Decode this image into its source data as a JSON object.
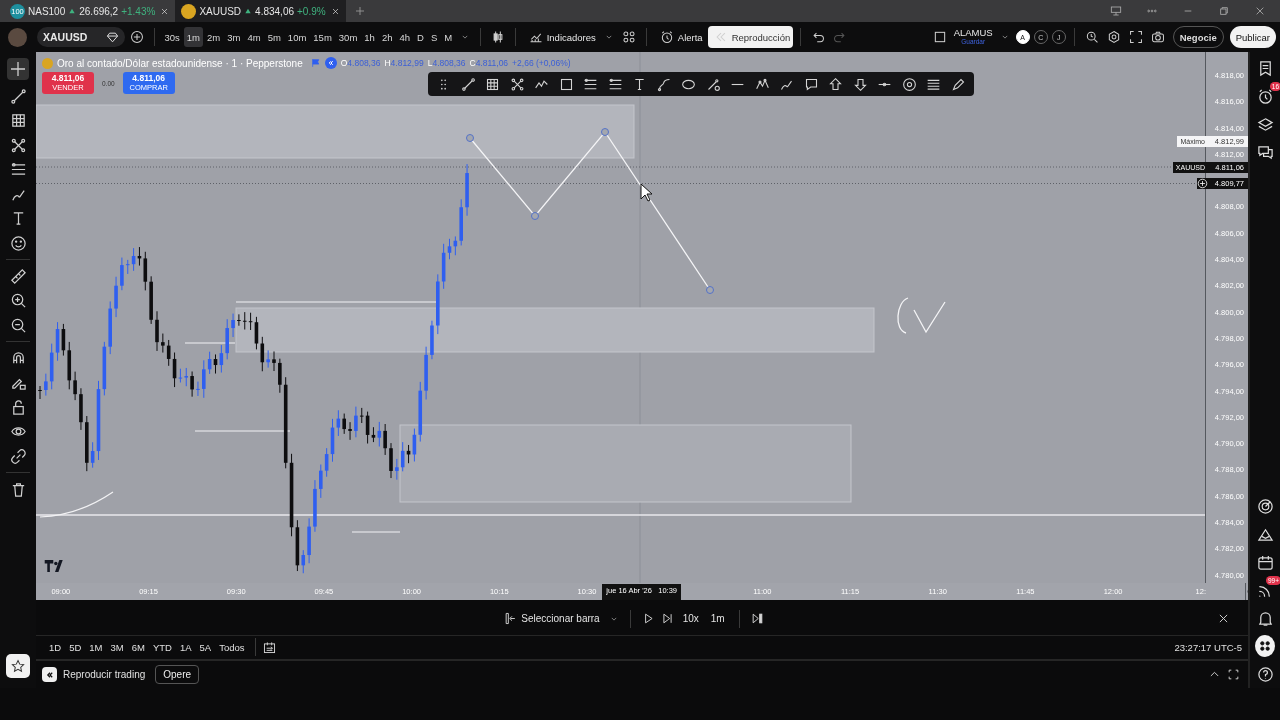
{
  "tabs": [
    {
      "symbol": "NAS100",
      "logo_text": "100",
      "color": "#1e8f9e",
      "price": "26.696,2",
      "change": "+1.43%",
      "selected": false
    },
    {
      "symbol": "XAUUSD",
      "color": "#d9a521",
      "price": "4.834,06",
      "change": "+0.9%",
      "selected": true
    }
  ],
  "toolbar": {
    "symbol": "XAUUSD",
    "intervals": [
      {
        "label": "30s",
        "selected": false
      },
      {
        "label": "1m",
        "selected": true
      },
      {
        "label": "2m",
        "selected": false
      },
      {
        "label": "3m",
        "selected": false
      },
      {
        "label": "4m",
        "selected": false
      },
      {
        "label": "5m",
        "selected": false
      },
      {
        "label": "10m",
        "selected": false
      },
      {
        "label": "15m",
        "selected": false
      },
      {
        "label": "30m",
        "selected": false
      },
      {
        "label": "1h",
        "selected": false
      },
      {
        "label": "2h",
        "selected": false
      },
      {
        "label": "4h",
        "selected": false
      },
      {
        "label": "D",
        "selected": false
      },
      {
        "label": "S",
        "selected": false
      },
      {
        "label": "M",
        "selected": false
      }
    ],
    "indicators": "Indicadores",
    "alert": "Alerta",
    "replay": {
      "label": "Reproducción",
      "active": true
    },
    "layout": {
      "name": "ALAMUS",
      "status": "Guardar"
    },
    "users": [
      {
        "initial": "A",
        "selected": true
      },
      {
        "initial": "C",
        "selected": false
      },
      {
        "initial": "J",
        "selected": false
      }
    ],
    "trade": "Negocie",
    "publish": "Publicar"
  },
  "legend": {
    "title": "Oro al contado/Dólar estadounidense · 1 · Pepperstone",
    "ohlc": [
      {
        "key": "O",
        "value": "4.808,36"
      },
      {
        "key": "H",
        "value": "4.812,99"
      },
      {
        "key": "L",
        "value": "4.808,36"
      },
      {
        "key": "C",
        "value": "4.811,06"
      }
    ],
    "change": "+2,66 (+0,06%)",
    "sell": {
      "price": "4.811,06",
      "label": "VENDER"
    },
    "spread": "0.00",
    "buy": {
      "price": "4.811,06",
      "label": "COMPRAR"
    }
  },
  "price_axis": {
    "ticks": [
      {
        "kind": "tick",
        "label": "4.818,00"
      },
      {
        "kind": "tick",
        "label": "4.816,00"
      },
      {
        "kind": "tick",
        "label": "4.814,00"
      },
      {
        "kind": "tick",
        "label": "4.812,00"
      },
      {
        "kind": "covered"
      },
      {
        "kind": "tick",
        "label": "4.808,00"
      },
      {
        "kind": "tick",
        "label": "4.806,00"
      },
      {
        "kind": "tick",
        "label": "4.804,00"
      },
      {
        "kind": "tick",
        "label": "4.802,00"
      },
      {
        "kind": "tick",
        "label": "4.800,00"
      },
      {
        "kind": "tick",
        "label": "4.798,00"
      },
      {
        "kind": "tick",
        "label": "4.796,00"
      },
      {
        "kind": "tick",
        "label": "4.794,00"
      },
      {
        "kind": "tick",
        "label": "4.792,00"
      },
      {
        "kind": "tick",
        "label": "4.790,00"
      },
      {
        "kind": "tick",
        "label": "4.788,00"
      },
      {
        "kind": "tick",
        "label": "4.786,00"
      },
      {
        "kind": "tick",
        "label": "4.784,00"
      },
      {
        "kind": "tick",
        "label": "4.782,00"
      },
      {
        "kind": "tick",
        "label": "4.780,00"
      }
    ],
    "labels": [
      {
        "kind": "high",
        "tag": "Máximo",
        "value": "4.812,99"
      },
      {
        "kind": "last",
        "tag": "XAUUSD",
        "value": "4.811,06"
      },
      {
        "kind": "cursor",
        "value": "4.809,77"
      }
    ]
  },
  "time_axis": [
    {
      "kind": "time",
      "label": "09:00"
    },
    {
      "kind": "time",
      "label": "09:15"
    },
    {
      "kind": "time",
      "label": "09:30"
    },
    {
      "kind": "time",
      "label": "09:45"
    },
    {
      "kind": "time",
      "label": "10:00"
    },
    {
      "kind": "time",
      "label": "10:15"
    },
    {
      "kind": "time",
      "label": "10:30"
    },
    {
      "kind": "cursor",
      "label": "jue 16 Abr '26   10:39"
    },
    {
      "kind": "time",
      "label": "11:00"
    },
    {
      "kind": "time",
      "label": "11:15"
    },
    {
      "kind": "time",
      "label": "11:30"
    },
    {
      "kind": "time",
      "label": "11:45"
    },
    {
      "kind": "time",
      "label": "12:00"
    },
    {
      "kind": "time",
      "label": "12:"
    }
  ],
  "replay_bar": {
    "select": "Seleccionar barra",
    "speed": "10x",
    "interval": "1m"
  },
  "ranges": [
    "1D",
    "5D",
    "1M",
    "3M",
    "6M",
    "YTD",
    "1A",
    "5A",
    "Todos"
  ],
  "clock": "23:27:17 UTC-5",
  "bottom_panel": {
    "title": "Reproducir trading",
    "button": "Opere"
  },
  "sidebar_badges": {
    "alerts": "16",
    "feed": "99+"
  }
}
